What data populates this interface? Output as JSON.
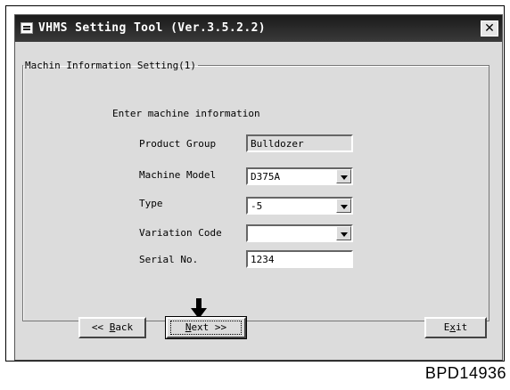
{
  "window": {
    "title": "VHMS Setting Tool (Ver.3.5.2.2)",
    "close_glyph": "✕"
  },
  "group": {
    "legend": "Machin Information Setting(1)"
  },
  "form": {
    "instruction": "Enter machine information",
    "product_group": {
      "label": "Product Group",
      "value": "Bulldozer"
    },
    "machine_model": {
      "label": "Machine Model",
      "value": "D375A"
    },
    "type": {
      "label": "Type",
      "value": "-5"
    },
    "variation_code": {
      "label": "Variation Code",
      "value": ""
    },
    "serial_no": {
      "label": "Serial No.",
      "value": "1234"
    }
  },
  "buttons": {
    "back_prefix": "<< ",
    "back_mnemonic": "B",
    "back_rest": "ack",
    "next_mnemonic": "N",
    "next_rest": "ext >>",
    "exit_prefix": "E",
    "exit_mnemonic": "x",
    "exit_rest": "it"
  },
  "caption": "BPD14936",
  "icons": {
    "app": "vhms-app-icon",
    "close": "close-icon",
    "dropdown": "chevron-down-icon",
    "pointer": "down-arrow-icon"
  }
}
